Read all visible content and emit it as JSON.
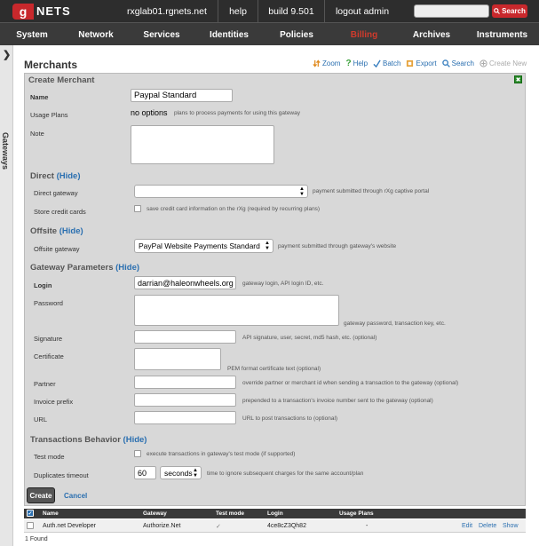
{
  "topbar": {
    "logo_letter": "g",
    "logo_text": "NETS",
    "host": "rxglab01.rgnets.net",
    "help": "help",
    "build": "build 9.501",
    "logout": "logout admin",
    "search_placeholder": "",
    "search_button": "Search"
  },
  "nav": [
    "System",
    "Network",
    "Services",
    "Identities",
    "Policies",
    "Billing",
    "Archives",
    "Instruments"
  ],
  "nav_active": "Billing",
  "sidebar": {
    "label": "Gateways"
  },
  "page": {
    "title": "Merchants"
  },
  "toolbar": {
    "zoom": "Zoom",
    "help": "Help",
    "batch": "Batch",
    "export": "Export",
    "search": "Search",
    "create_new": "Create New"
  },
  "form": {
    "title": "Create Merchant",
    "name_label": "Name",
    "name_value": "Paypal Standard",
    "usage_plans_label": "Usage Plans",
    "usage_plans_value": "no options",
    "usage_plans_help": "plans to process payments for using this gateway",
    "note_label": "Note",
    "direct_section": "Direct",
    "hide": "(Hide)",
    "direct_gateway_label": "Direct gateway",
    "direct_gateway_value": "",
    "direct_gateway_help": "payment submitted through rXg captive portal",
    "store_cc_label": "Store credit cards",
    "store_cc_help": "save credit card information on the rXg (required by recurring plans)",
    "offsite_section": "Offsite",
    "offsite_gateway_label": "Offsite gateway",
    "offsite_gateway_value": "PayPal Website Payments Standard",
    "offsite_gateway_help": "payment submitted through gateway's website",
    "gateway_params_section": "Gateway Parameters",
    "login_label": "Login",
    "login_value": "darrian@haleonwheels.org",
    "login_help": "gateway login, API login ID, etc.",
    "password_label": "Password",
    "password_help": "gateway password, transaction key, etc.",
    "signature_label": "Signature",
    "signature_help": "API signature, user, secret, md5 hash, etc. (optional)",
    "certificate_label": "Certificate",
    "certificate_help": "PEM format certificate text (optional)",
    "partner_label": "Partner",
    "partner_help": "override partner or merchant id when sending a transaction to the gateway (optional)",
    "invoice_prefix_label": "Invoice prefix",
    "invoice_prefix_help": "prepended to a transaction's invoice number sent to the gateway (optional)",
    "url_label": "URL",
    "url_help": "URL to post transactions to (optional)",
    "transactions_section": "Transactions Behavior",
    "test_mode_label": "Test mode",
    "test_mode_help": "execute transactions in gateway's test mode (if supported)",
    "dup_timeout_label": "Duplicates timeout",
    "dup_timeout_value": "60",
    "dup_timeout_unit": "seconds",
    "dup_timeout_help": "time to ignore subsequent charges for the same account/plan",
    "create_button": "Create",
    "cancel_link": "Cancel"
  },
  "table": {
    "headers": [
      "Name",
      "Gateway",
      "Test mode",
      "Login",
      "Usage Plans"
    ],
    "rows": [
      {
        "name": "Auth.net Developer",
        "gateway": "Authorize.Net",
        "test_mode": "✓",
        "login": "4ce8cZ3Qh82",
        "usage_plans": "-",
        "edit": "Edit",
        "delete": "Delete",
        "show": "Show"
      }
    ],
    "found": "1 Found"
  },
  "colors": {
    "brand": "#c8282c",
    "link": "#2a6fb0",
    "topbar": "#2d2d2d",
    "panel": "#d8d8d8"
  }
}
